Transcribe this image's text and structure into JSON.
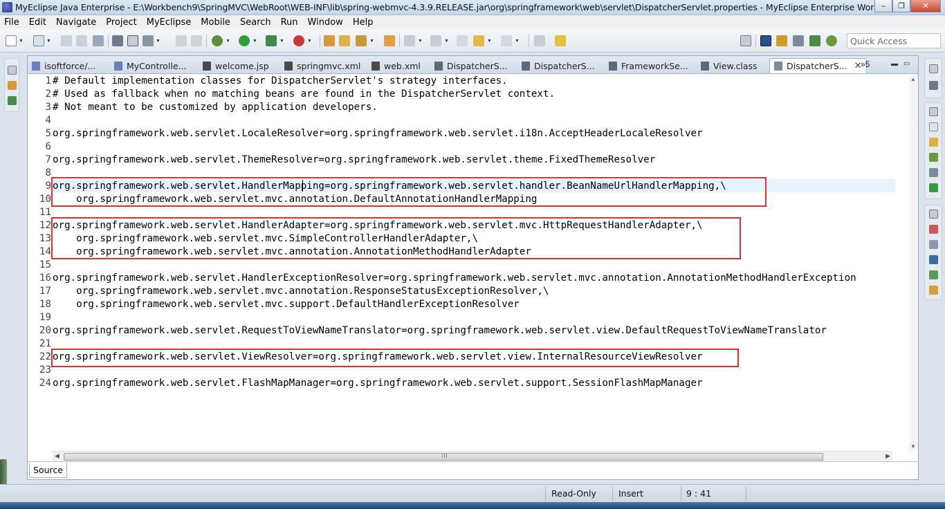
{
  "window": {
    "title": "MyEclipse Java Enterprise - E:\\Workbench9\\SpringMVC\\WebRoot\\WEB-INF\\lib\\spring-webmvc-4.3.9.RELEASE.jar\\org\\springframework\\web\\servlet\\DispatcherServlet.properties - MyEclipse Enterprise Workbench",
    "minimize_glyph": "–",
    "restore_glyph": "❐",
    "close_glyph": "✕"
  },
  "menu": {
    "items": [
      "File",
      "Edit",
      "Navigate",
      "Project",
      "MyEclipse",
      "Mobile",
      "Search",
      "Run",
      "Window",
      "Help"
    ]
  },
  "toolbar": {
    "quick_access_placeholder": "Quick Access"
  },
  "tabs": [
    {
      "label": "isoftforce/...",
      "icon": "java-file-icon",
      "color": "#6b7fb8"
    },
    {
      "label": "MyControlle...",
      "icon": "java-file-icon",
      "color": "#6b7fb8"
    },
    {
      "label": "welcome.jsp",
      "icon": "jsp-file-icon",
      "color": "#4a4a4a"
    },
    {
      "label": "springmvc.xml",
      "icon": "xml-file-icon",
      "color": "#4a4a4a"
    },
    {
      "label": "web.xml",
      "icon": "xml-file-icon",
      "color": "#4a4a4a"
    },
    {
      "label": "DispatcherS...",
      "icon": "class-file-icon",
      "color": "#5a6a7a"
    },
    {
      "label": "DispatcherS...",
      "icon": "class-file-icon",
      "color": "#5a6a7a"
    },
    {
      "label": "FrameworkSe...",
      "icon": "class-file-icon",
      "color": "#5a6a7a"
    },
    {
      "label": "View.class",
      "icon": "class-file-icon",
      "color": "#5a6a7a"
    },
    {
      "label": "DispatcherS...",
      "icon": "properties-file-icon",
      "color": "#7a8a9a",
      "active": true
    }
  ],
  "tab_overflow": "»5",
  "editor": {
    "lines": [
      {
        "no": "1",
        "text": "# Default implementation classes for DispatcherServlet's strategy interfaces."
      },
      {
        "no": "2",
        "text": "# Used as fallback when no matching beans are found in the DispatcherServlet context."
      },
      {
        "no": "3",
        "text": "# Not meant to be customized by application developers."
      },
      {
        "no": "4",
        "text": ""
      },
      {
        "no": "5",
        "text": "org.springframework.web.servlet.LocaleResolver=org.springframework.web.servlet.i18n.AcceptHeaderLocaleResolver"
      },
      {
        "no": "6",
        "text": ""
      },
      {
        "no": "7",
        "text": "org.springframework.web.servlet.ThemeResolver=org.springframework.web.servlet.theme.FixedThemeResolver"
      },
      {
        "no": "8",
        "text": ""
      },
      {
        "no": "9",
        "text": "org.springframework.web.servlet.HandlerMapping=org.springframework.web.servlet.handler.BeanNameUrlHandlerMapping,\\"
      },
      {
        "no": "10",
        "text": "    org.springframework.web.servlet.mvc.annotation.DefaultAnnotationHandlerMapping"
      },
      {
        "no": "11",
        "text": ""
      },
      {
        "no": "12",
        "text": "org.springframework.web.servlet.HandlerAdapter=org.springframework.web.servlet.mvc.HttpRequestHandlerAdapter,\\"
      },
      {
        "no": "13",
        "text": "    org.springframework.web.servlet.mvc.SimpleControllerHandlerAdapter,\\"
      },
      {
        "no": "14",
        "text": "    org.springframework.web.servlet.mvc.annotation.AnnotationMethodHandlerAdapter"
      },
      {
        "no": "15",
        "text": ""
      },
      {
        "no": "16",
        "text": "org.springframework.web.servlet.HandlerExceptionResolver=org.springframework.web.servlet.mvc.annotation.AnnotationMethodHandlerException"
      },
      {
        "no": "17",
        "text": "    org.springframework.web.servlet.mvc.annotation.ResponseStatusExceptionResolver,\\"
      },
      {
        "no": "18",
        "text": "    org.springframework.web.servlet.mvc.support.DefaultHandlerExceptionResolver"
      },
      {
        "no": "19",
        "text": ""
      },
      {
        "no": "20",
        "text": "org.springframework.web.servlet.RequestToViewNameTranslator=org.springframework.web.servlet.view.DefaultRequestToViewNameTranslator"
      },
      {
        "no": "21",
        "text": ""
      },
      {
        "no": "22",
        "text": "org.springframework.web.servlet.ViewResolver=org.springframework.web.servlet.view.InternalResourceViewResolver"
      },
      {
        "no": "23",
        "text": ""
      },
      {
        "no": "24",
        "text": "org.springframework.web.servlet.FlashMapManager=org.springframework.web.servlet.support.SessionFlashMapManager"
      }
    ],
    "current_line": 9,
    "highlight_color": "#e03030",
    "hscroll_grip": "III"
  },
  "source_tab": "Source",
  "status": {
    "mode": "Read-Only",
    "insert": "Insert",
    "position": "9 : 41"
  }
}
